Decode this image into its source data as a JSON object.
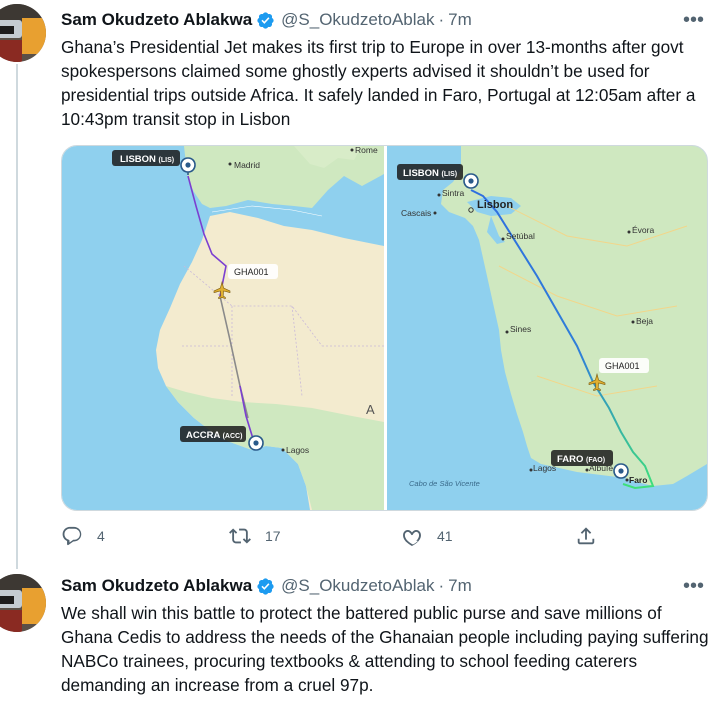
{
  "tweets": [
    {
      "author_name": "Sam Okudzeto Ablakwa",
      "handle": "@S_OkudzetoAblak",
      "separator": "·",
      "time": "7m",
      "more": "•••",
      "text": "Ghana’s Presidential Jet makes its first trip to Europe in over 13-months after govt spokespersons claimed some ghostly experts advised it shouldn’t be used for presidential trips outside Africa. It safely landed in Faro, Portugal at 12:05am after a 10:43pm transit stop in Lisbon",
      "actions": {
        "reply_count": "4",
        "retweet_count": "17",
        "like_count": "41"
      }
    },
    {
      "author_name": "Sam Okudzeto Ablakwa",
      "handle": "@S_OkudzetoAblak",
      "separator": "·",
      "time": "7m",
      "more": "•••",
      "text": "We shall win this battle to protect the battered public purse and save millions of Ghana Cedis to address the needs of the Ghanaian people including paying suffering NABCo trainees, procuring textbooks & attending to school feeding caterers demanding an increase from a cruel 97p."
    }
  ],
  "map_left": {
    "origin_label": "LISBON",
    "origin_code": "(LIS)",
    "dest_label": "ACCRA",
    "dest_code": "(ACC)",
    "flight_label": "GHA001",
    "places": [
      "Madrid",
      "Rome",
      "Lagos",
      "A"
    ]
  },
  "map_right": {
    "origin_label": "LISBON",
    "origin_code": "(LIS)",
    "dest_label": "FARO",
    "dest_code": "(FAO)",
    "flight_label": "GHA001",
    "places": [
      "Sintra",
      "Lisbon",
      "Cascais",
      "Setúbal",
      "Évora",
      "Sines",
      "Beja",
      "Lagos",
      "Albufe",
      "Faro",
      "Cabo de São Vicente"
    ]
  },
  "icons": {
    "verified": "verified-badge-icon",
    "reply": "reply-icon",
    "retweet": "retweet-icon",
    "like": "heart-icon",
    "share": "share-icon",
    "location_pin": "location-pin-icon",
    "plane": "plane-icon"
  },
  "colors": {
    "verified_blue": "#1d9bf0",
    "text_primary": "#0f1419",
    "text_secondary": "#536471",
    "route_purple": "#7b3fd1",
    "route_gradient_start": "#2f6fe0",
    "route_gradient_end": "#3ee07a",
    "sea": "#8fd0ee",
    "land_desert": "#f3ebcf",
    "land_green": "#cfe8c0"
  }
}
